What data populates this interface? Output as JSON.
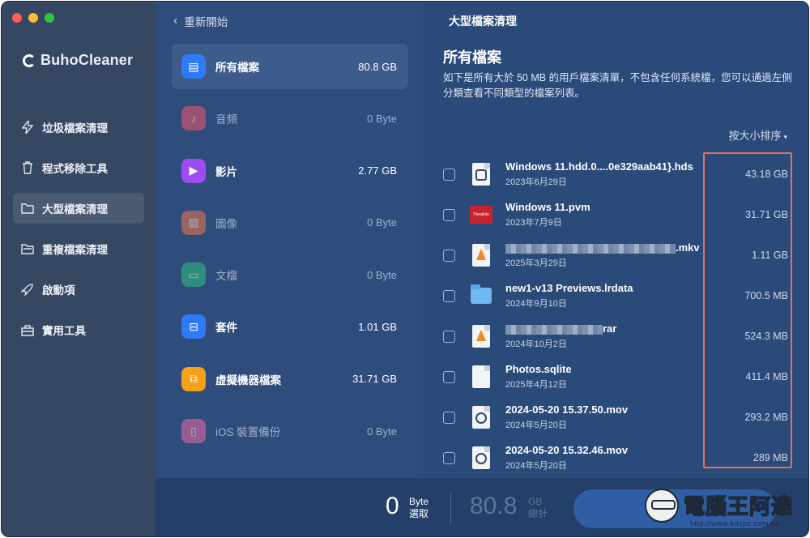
{
  "sidebar": {
    "app_name": "BuhoCleaner",
    "items": [
      {
        "label": "垃圾檔案清理",
        "icon": "lightning-icon",
        "active": false
      },
      {
        "label": "程式移除工具",
        "icon": "trash-icon",
        "active": false
      },
      {
        "label": "大型檔案清理",
        "icon": "folder-icon",
        "active": true
      },
      {
        "label": "重複檔案清理",
        "icon": "duplicate-folder-icon",
        "active": false
      },
      {
        "label": "啟動項",
        "icon": "rocket-icon",
        "active": false
      },
      {
        "label": "實用工具",
        "icon": "toolbox-icon",
        "active": false
      }
    ]
  },
  "categories": {
    "back_label": "重新開始",
    "items": [
      {
        "label": "所有檔案",
        "size": "80.8 GB",
        "color": "#2f7bf5",
        "icon": "all-files-icon"
      },
      {
        "label": "音頻",
        "size": "0 Byte",
        "color": "#f2556e",
        "icon": "audio-icon"
      },
      {
        "label": "影片",
        "size": "2.77 GB",
        "color": "#9c4cf0",
        "icon": "video-icon"
      },
      {
        "label": "圖像",
        "size": "0 Byte",
        "color": "#f2784f",
        "icon": "image-icon"
      },
      {
        "label": "文檔",
        "size": "0 Byte",
        "color": "#2ec27e",
        "icon": "document-icon"
      },
      {
        "label": "套件",
        "size": "1.01 GB",
        "color": "#2f7bf5",
        "icon": "package-icon"
      },
      {
        "label": "虛擬機器檔案",
        "size": "31.71 GB",
        "color": "#f3a21a",
        "icon": "virtual-machine-icon"
      },
      {
        "label": "iOS 裝置備份",
        "size": "0 Byte",
        "color": "#f06ba7",
        "icon": "ios-backup-icon"
      }
    ]
  },
  "main": {
    "page_title": "大型檔案清理",
    "section_title": "所有檔案",
    "description": "如下是所有大於 50 MB 的用戶檔案清單，不包含任何系統檔，您可以通過左側分類查看不同類型的檔案列表。",
    "sort_label": "按大小排序",
    "files": [
      {
        "name": "Windows 11.hdd.0....0e329aab41}.hds",
        "date": "2023年6月29日",
        "size": "43.18 GB",
        "icon": "hdd-file-icon",
        "blurred": false
      },
      {
        "name": "Windows 11.pvm",
        "date": "2023年7月9日",
        "size": "31.71 GB",
        "icon": "parallels-icon",
        "blurred": false
      },
      {
        "name": ".mkv",
        "date": "2025年3月29日",
        "size": "1.11 GB",
        "icon": "vlc-mkv-icon",
        "blurred": true
      },
      {
        "name": "new1-v13 Previews.lrdata",
        "date": "2024年9月10日",
        "size": "700.5 MB",
        "icon": "folder-icon",
        "blurred": false
      },
      {
        "name": "rar",
        "date": "2024年10月2日",
        "size": "524.3 MB",
        "icon": "vlc-icon",
        "blurred": true
      },
      {
        "name": "Photos.sqlite",
        "date": "2025年4月12日",
        "size": "411.4 MB",
        "icon": "blank-file-icon",
        "blurred": false
      },
      {
        "name": "2024-05-20 15.37.50.mov",
        "date": "2024年5月20日",
        "size": "293.2 MB",
        "icon": "quicktime-icon",
        "blurred": false
      },
      {
        "name": "2024-05-20 15.32.46.mov",
        "date": "2024年5月20日",
        "size": "289 MB",
        "icon": "quicktime-icon",
        "blurred": false
      }
    ]
  },
  "bottom": {
    "selected_value": "0",
    "selected_unit": "Byte",
    "selected_label": "選取",
    "total_value": "80.8",
    "total_unit": "GB",
    "total_label": "總計"
  },
  "watermark": {
    "text": "電腦王阿達",
    "url": "http://www.kocpc.com.tw"
  }
}
